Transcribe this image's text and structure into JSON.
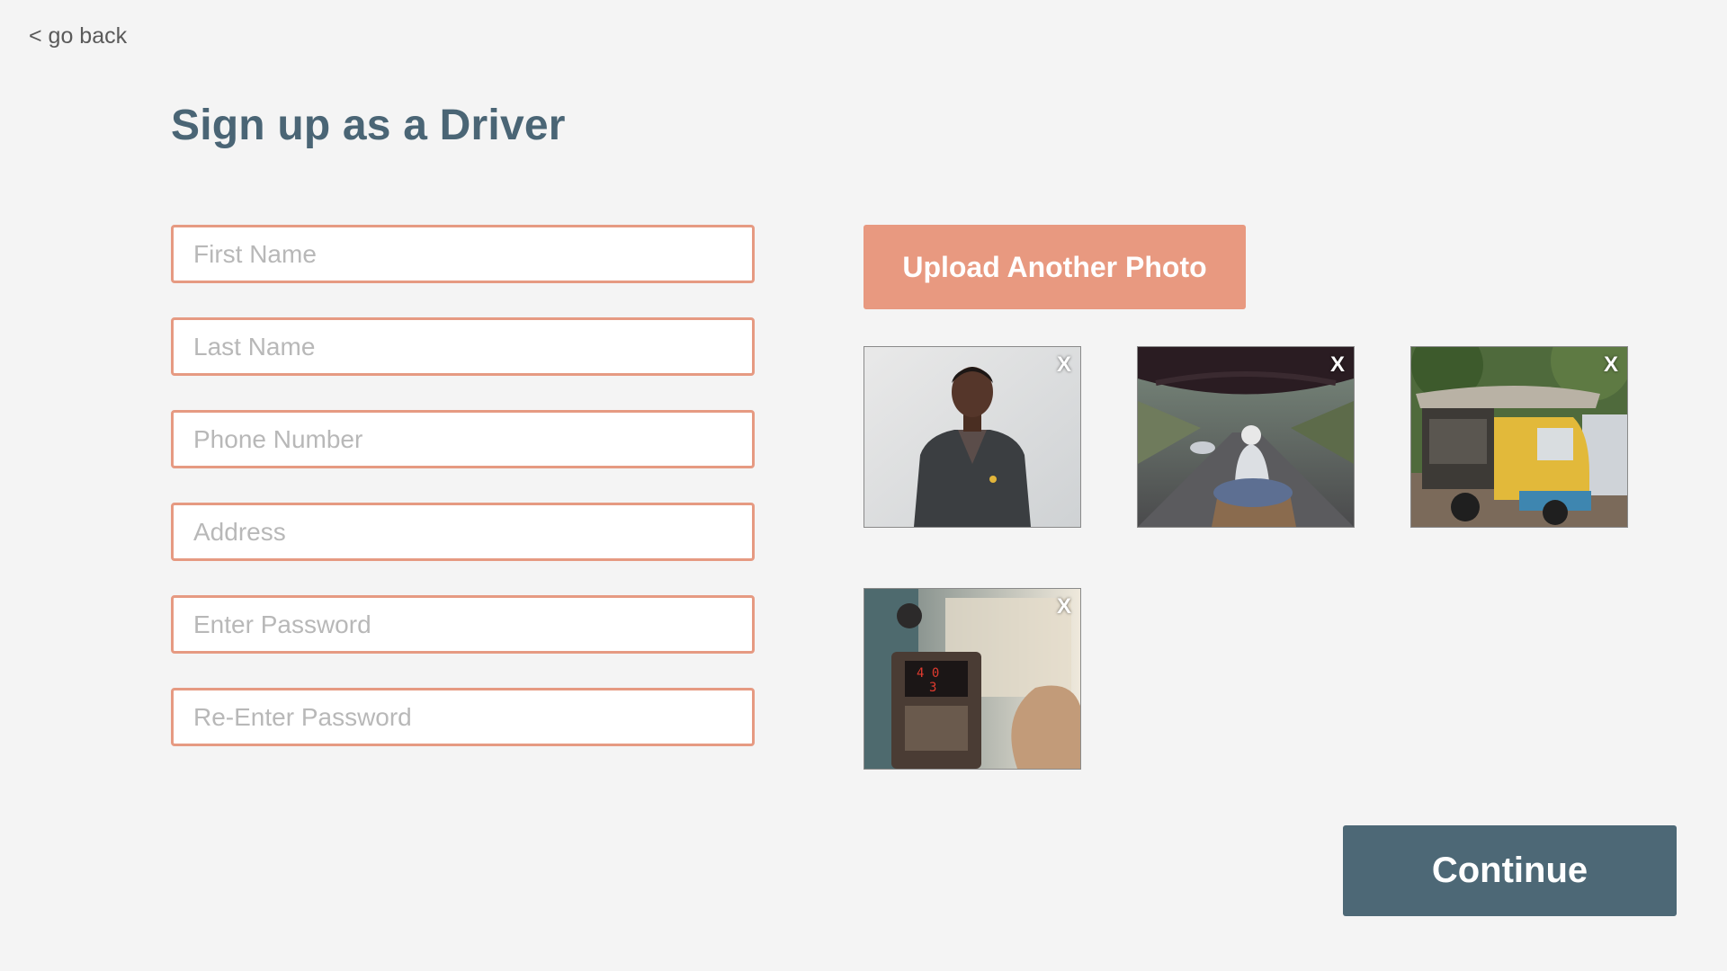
{
  "nav": {
    "back_label": "< go back"
  },
  "page": {
    "title": "Sign up as a Driver"
  },
  "form": {
    "first_name_placeholder": "First Name",
    "last_name_placeholder": "Last Name",
    "phone_placeholder": "Phone Number",
    "address_placeholder": "Address",
    "password_placeholder": "Enter Password",
    "reenter_password_placeholder": "Re-Enter Password"
  },
  "photos": {
    "upload_label": "Upload Another Photo",
    "remove_label": "X",
    "items": [
      {
        "icon": "driver-portrait-photo"
      },
      {
        "icon": "rickshaw-ride-photo"
      },
      {
        "icon": "tuk-tuk-photo"
      },
      {
        "icon": "taxi-meter-photo"
      }
    ]
  },
  "actions": {
    "continue_label": "Continue"
  },
  "colors": {
    "background": "#f4f4f4",
    "accent": "#e89980",
    "input_border": "#e69a82",
    "primary": "#4d6876",
    "title": "#4a6575"
  }
}
